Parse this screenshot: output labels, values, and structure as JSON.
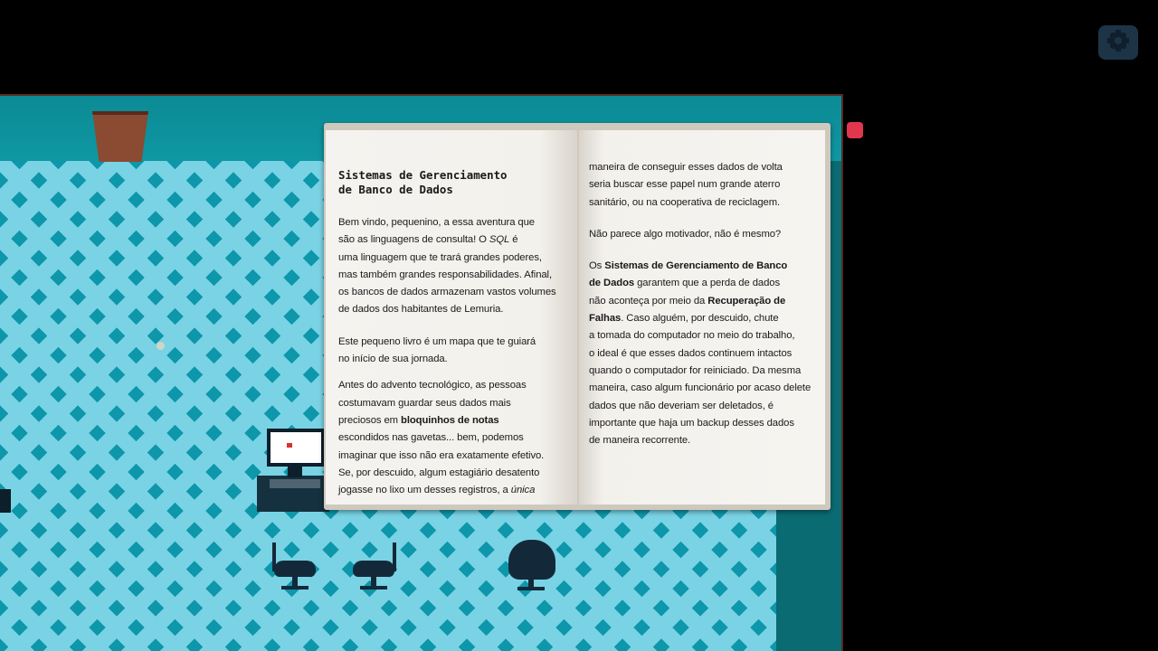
{
  "book": {
    "title_line1": "Sistemas de Gerenciamento",
    "title_line2": "de Banco de Dados",
    "left_page": [
      [
        "Bem vindo, pequenino, a essa aventura que",
        "são as linguagens de consulta! O ",
        "SQL",
        " é",
        "uma linguagem que te trará grandes poderes,",
        "mas também grandes responsabilidades. Afinal,",
        "os bancos de dados armazenam vastos volumes",
        "de dados dos habitantes de Lemuria."
      ],
      [
        "Este pequeno livro é um mapa que te guiará",
        "no início de sua jornada."
      ],
      [
        "Antes do advento tecnológico, as pessoas",
        "costumavam guardar seus dados mais",
        "preciosos em ",
        "bloquinhos de notas",
        "escondidos nas gavetas... bem, podemos",
        "imaginar que isso não era exatamente efetivo.",
        "Se, por descuido, algum estagiário desatento",
        "jogasse no lixo um desses registros, a ",
        "única"
      ]
    ],
    "right_page": [
      [
        "maneira de conseguir esses dados de volta",
        "seria buscar esse papel num grande aterro",
        "sanitário, ou na cooperativa de reciclagem."
      ],
      [
        "Não parece algo motivador, não é mesmo?"
      ],
      [
        "Os ",
        "Sistemas de Gerenciamento de Banco",
        "de Dados",
        " garantem que a perda de dados",
        "não aconteça por meio da ",
        "Recuperação de",
        "Falhas",
        ". Caso alguém, por descuido, chute",
        "a tomada do computador no meio do trabalho,",
        "o ideal é que esses dados continuem intactos",
        "quando o computador for reiniciado. Da mesma",
        "maneira, caso algum funcionário por acaso delete",
        "dados que não deveriam ser deletados, é",
        "importante que haja um backup desses dados",
        "de maneira recorrente."
      ]
    ]
  },
  "ui": {
    "settings_icon": "gear-icon",
    "close_marker_color": "#e0374f",
    "floor_color": "#0e97aa",
    "tile_color": "#79d3e4"
  }
}
